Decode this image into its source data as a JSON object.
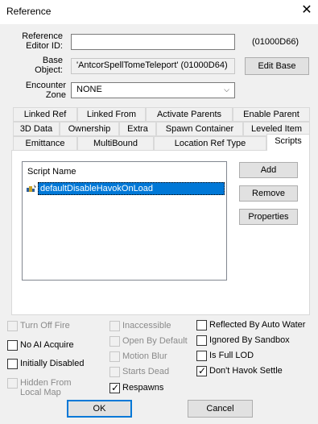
{
  "window": {
    "title": "Reference",
    "close_glyph": "✕"
  },
  "form": {
    "editor_id_label_1": "Reference",
    "editor_id_label_2": "Editor ID:",
    "editor_id_value": "",
    "form_id": "(01000D66)",
    "base_label_1": "Base",
    "base_label_2": "Object:",
    "base_value": "'AntcorSpellTomeTeleport' (01000D64)",
    "edit_base_label": "Edit Base",
    "encounter_label_1": "Encounter",
    "encounter_label_2": "Zone",
    "encounter_value": "NONE"
  },
  "tabs": {
    "row1": [
      "Linked Ref",
      "Linked From",
      "Activate Parents",
      "Enable Parent"
    ],
    "row2": [
      "3D Data",
      "Ownership",
      "Extra",
      "Spawn Container",
      "Leveled Item"
    ],
    "row3": [
      "Emittance",
      "MultiBound",
      "Location Ref Type",
      "Scripts"
    ],
    "active": "Scripts"
  },
  "scripts": {
    "header": "Script Name",
    "items": [
      "defaultDisableHavokOnLoad"
    ],
    "add_label": "Add",
    "remove_label": "Remove",
    "properties_label": "Properties"
  },
  "flags": {
    "col1": [
      {
        "label": "Turn Off Fire",
        "checked": false,
        "enabled": false
      },
      {
        "label": "No AI Acquire",
        "checked": false,
        "enabled": true
      },
      {
        "label": "Initially Disabled",
        "checked": false,
        "enabled": true
      },
      {
        "label": "Hidden From",
        "label2": "Local Map",
        "checked": false,
        "enabled": false
      }
    ],
    "col2": [
      {
        "label": "Inaccessible",
        "checked": false,
        "enabled": false
      },
      {
        "label": "Open By Default",
        "checked": false,
        "enabled": false
      },
      {
        "label": "Motion Blur",
        "checked": false,
        "enabled": false
      },
      {
        "label": "Starts Dead",
        "checked": false,
        "enabled": false
      },
      {
        "label": "Respawns",
        "checked": true,
        "enabled": true
      }
    ],
    "col3": [
      {
        "label": "Reflected By Auto Water",
        "checked": false,
        "enabled": true
      },
      {
        "label": "Ignored By Sandbox",
        "checked": false,
        "enabled": true
      },
      {
        "label": "Is Full LOD",
        "checked": false,
        "enabled": true
      },
      {
        "label": "Don't Havok Settle",
        "checked": true,
        "enabled": true
      }
    ]
  },
  "footer": {
    "ok_label": "OK",
    "cancel_label": "Cancel"
  },
  "colors": {
    "accent": "#0078d7",
    "selection_bg": "#0078d7"
  }
}
